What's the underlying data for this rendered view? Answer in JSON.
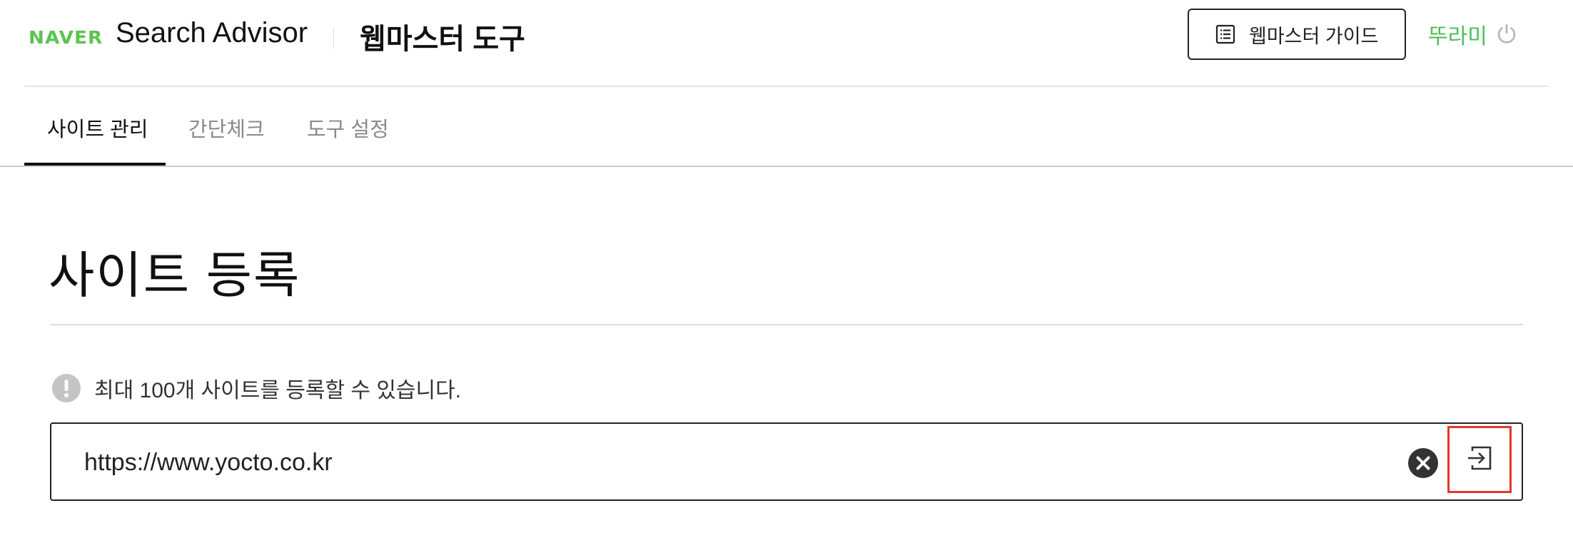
{
  "header": {
    "logo": "NAVER",
    "app_name": "Search Advisor",
    "tool_name": "웹마스터 도구",
    "guide_button_label": "웹마스터 가이드",
    "user_name": "뚜라미"
  },
  "tabs": [
    {
      "label": "사이트 관리",
      "active": true
    },
    {
      "label": "간단체크",
      "active": false
    },
    {
      "label": "도구 설정",
      "active": false
    }
  ],
  "main": {
    "title": "사이트 등록",
    "notice": "최대 100개 사이트를 등록할 수 있습니다.",
    "url_input": {
      "value": "https://www.yocto.co.kr"
    }
  },
  "icons": {
    "guide": "list-document-icon",
    "power": "power-icon",
    "notice": "exclamation-circle-icon",
    "clear": "close-circle-icon",
    "submit": "login-arrow-icon"
  },
  "colors": {
    "brand_green": "#5ac451",
    "user_green": "#4cbe5a",
    "highlight_red": "#e0392b",
    "text_dark": "#111111",
    "text_muted": "#8a8a8a"
  }
}
